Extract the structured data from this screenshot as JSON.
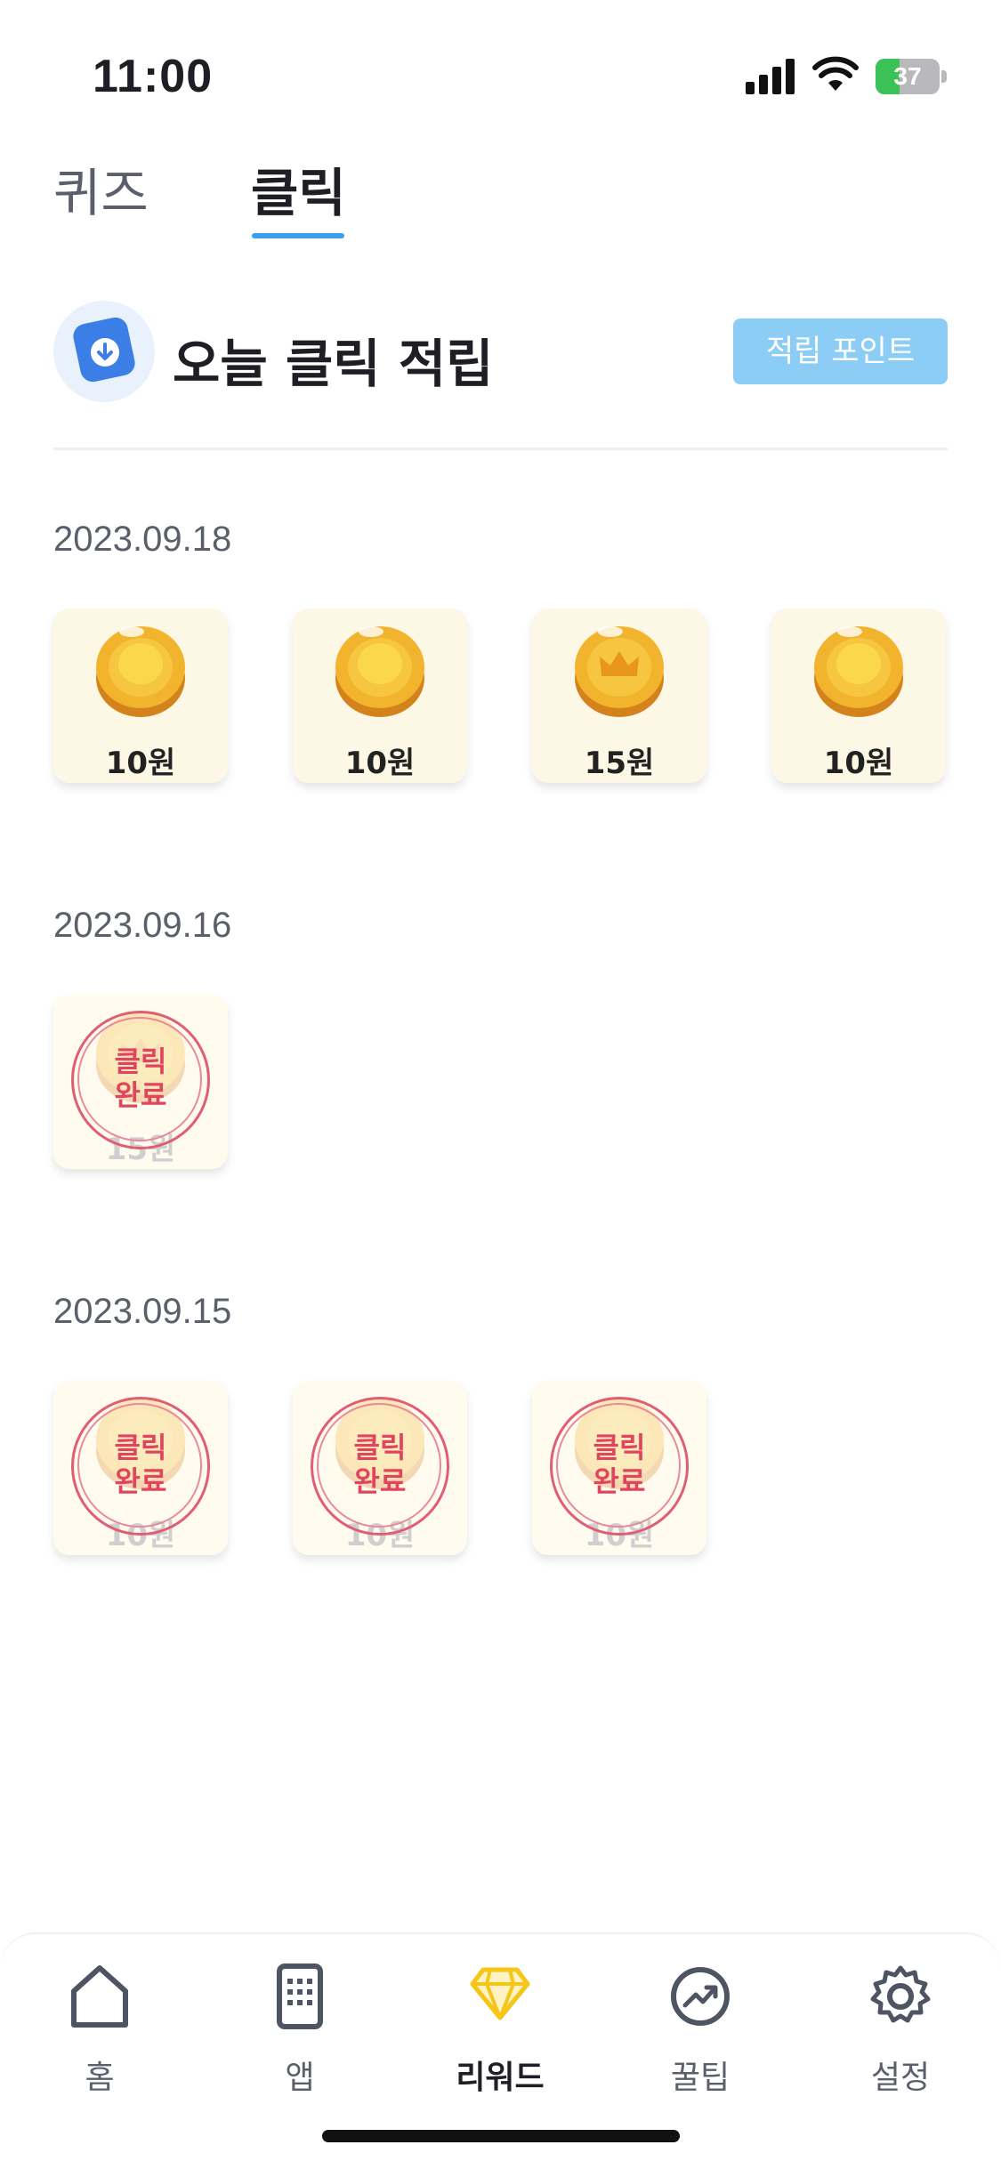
{
  "status_bar": {
    "time": "11:00",
    "battery": "37",
    "battery_level": 0.37
  },
  "tabs": [
    {
      "label": "퀴즈"
    },
    {
      "label": "클릭"
    }
  ],
  "header": {
    "title": "오늘 클릭 적립",
    "points_button": "적립 포인트"
  },
  "sections": [
    {
      "date": "2023.09.18",
      "items": [
        "10원",
        "10원",
        "15원",
        "10원"
      ]
    },
    {
      "date": "2023.09.16",
      "items": [
        "15원"
      ]
    },
    {
      "date": "2023.09.15",
      "items": [
        "10원",
        "10원",
        "10원"
      ]
    }
  ],
  "stamp_text": {
    "line1": "클릭",
    "line2": "완료"
  },
  "bottom_nav": [
    {
      "label": "홈",
      "icon": "home-icon"
    },
    {
      "label": "앱",
      "icon": "app-grid-icon"
    },
    {
      "label": "리워드",
      "icon": "diamond-icon"
    },
    {
      "label": "꿀팁",
      "icon": "trend-icon"
    },
    {
      "label": "설정",
      "icon": "gear-icon"
    }
  ],
  "colors": {
    "accent": "#3a9fee",
    "points_button": "#8ccdf5",
    "stamp": "#e0445f",
    "coin": "#f2b42c",
    "reward_active": "#f5c518"
  }
}
